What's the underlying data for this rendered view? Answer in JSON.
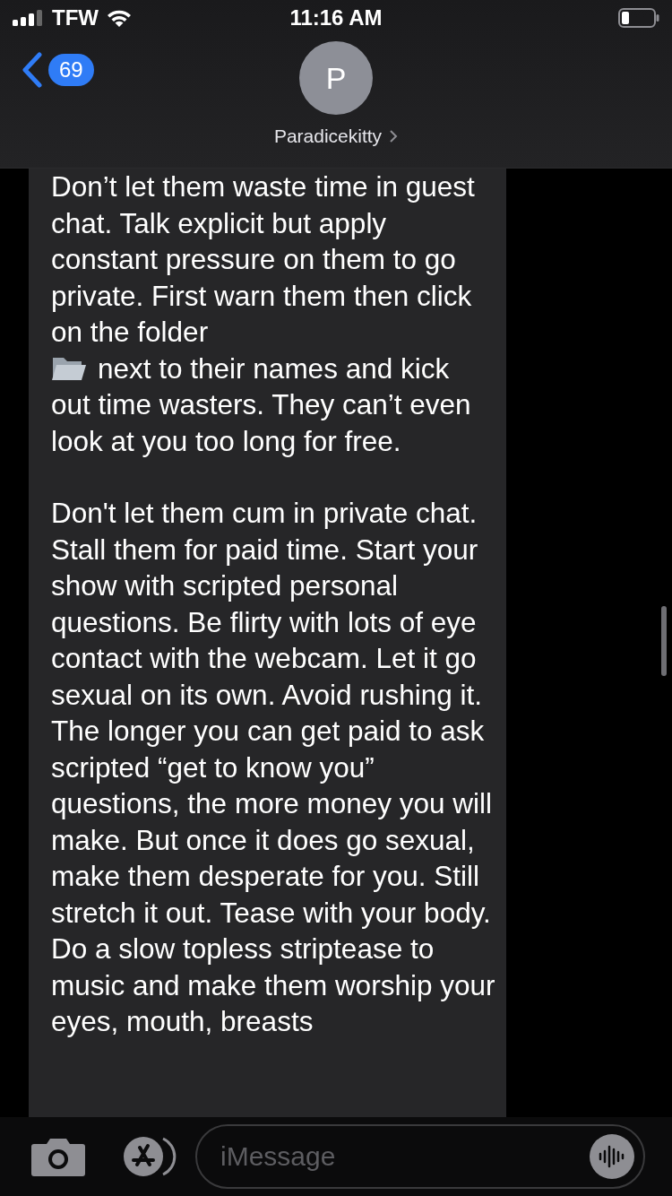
{
  "status_bar": {
    "carrier": "TFW",
    "time": "11:16 AM"
  },
  "header": {
    "back_count": "69",
    "avatar_initial": "P",
    "contact_name": "Paradicekitty"
  },
  "message": {
    "paragraphs": [
      {
        "before_icon": "Don’t let them waste time in guest chat. Talk explicit but apply constant pressure on them to go private. First warn them then click on the folder",
        "after_icon": "next to their names and kick",
        "continuation": "out time wasters. They can’t even look at you too long for free."
      },
      {
        "before_icon": "Don't let them cum in private chat. Stall them for paid time. Start your show with scripted personal questions. Be flirty with lots of eye contact with the webcam. Let it go sexual on its own. Avoid rushing it. The longer you can get paid to ask scripted “get to know you” questions, the more money you will make. But once it does go sexual, make them desperate for you. Still stretch it out. Tease with your body. Do a slow topless striptease to music and make them worship your eyes, mouth, breasts"
      }
    ]
  },
  "composer": {
    "placeholder": "iMessage"
  }
}
